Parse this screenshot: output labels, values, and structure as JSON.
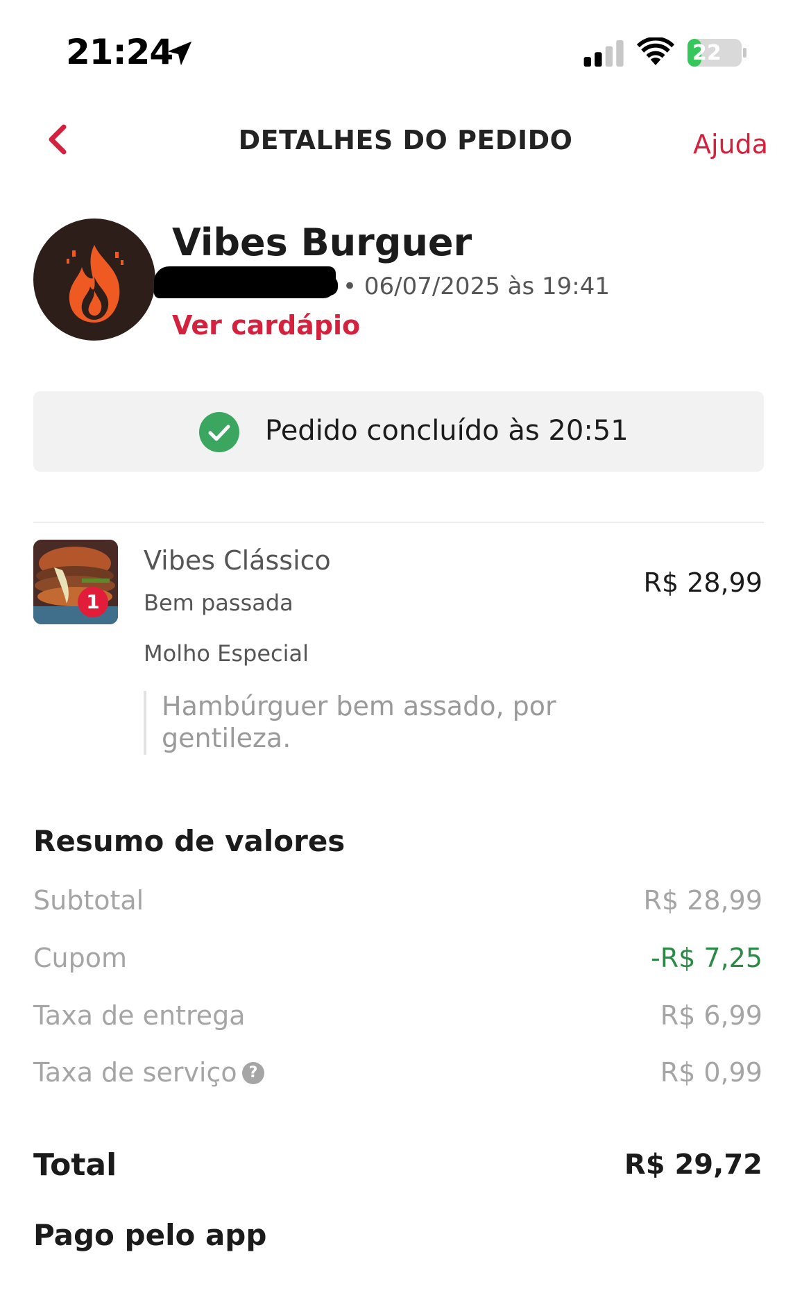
{
  "status_bar": {
    "time": "21:24",
    "battery": "22",
    "icons": [
      "location-arrow-icon",
      "signal-icon",
      "wifi-icon",
      "battery-icon"
    ]
  },
  "header": {
    "title": "DETALHES DO PEDIDO",
    "help_label": "Ajuda"
  },
  "store": {
    "name": "Vibes Burguer",
    "order_datetime": "• 06/07/2025 às 19:41",
    "menu_link": "Ver cardápio"
  },
  "order_status": {
    "text": "Pedido concluído às 20:51"
  },
  "items": [
    {
      "name": "Vibes Clássico",
      "quantity": "1",
      "price": "R$ 28,99",
      "options": [
        "Bem passada",
        "Molho Especial"
      ],
      "note": "Hambúrguer bem assado, por gentileza."
    }
  ],
  "summary": {
    "title": "Resumo de valores",
    "rows": [
      {
        "label": "Subtotal",
        "value": "R$ 28,99"
      },
      {
        "label": "Cupom",
        "value": "-R$ 7,25"
      },
      {
        "label": "Taxa de entrega",
        "value": "R$ 6,99"
      },
      {
        "label": "Taxa de serviço",
        "value": "R$ 0,99"
      }
    ],
    "info_icon": "?",
    "total_label": "Total",
    "total_value": "R$ 29,72",
    "payment_label": "Pago pelo app"
  },
  "colors": {
    "accent": "#d3213e",
    "success": "#3aa660",
    "discount": "#2b8a45",
    "battery_green": "#34c759"
  }
}
